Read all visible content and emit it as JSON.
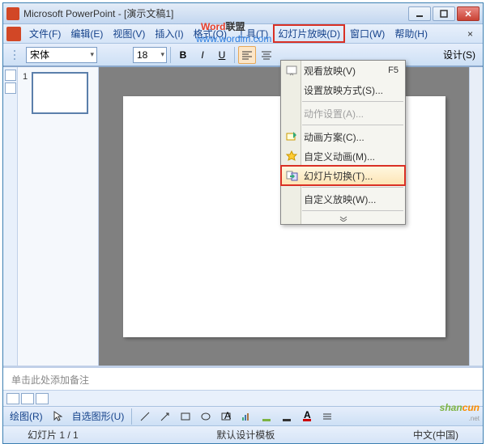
{
  "title": "Microsoft PowerPoint - [演示文稿1]",
  "menubar": {
    "file": "文件(F)",
    "edit": "编辑(E)",
    "view": "视图(V)",
    "insert": "插入(I)",
    "format": "格式(O)",
    "tools": "工具(T)",
    "slideshow": "幻灯片放映(D)",
    "window": "窗口(W)",
    "help": "帮助(H)"
  },
  "toolbar": {
    "font_name": "宋体",
    "font_size": "18",
    "design_btn": "设计(S)"
  },
  "dropdown": {
    "view_show": "观看放映(V)",
    "view_show_key": "F5",
    "setup_show": "设置放映方式(S)...",
    "action_settings": "动作设置(A)...",
    "animation_schemes": "动画方案(C)...",
    "custom_animation": "自定义动画(M)...",
    "slide_transition": "幻灯片切换(T)...",
    "custom_shows": "自定义放映(W)..."
  },
  "thumb": {
    "num": "1"
  },
  "notes": {
    "placeholder": "单击此处添加备注"
  },
  "drawbar": {
    "draw": "绘图(R)",
    "autoshapes": "自选图形(U)"
  },
  "status": {
    "slide": "幻灯片 1 / 1",
    "template": "默认设计模板",
    "lang": "中文(中国)"
  },
  "watermark": {
    "word": "Word",
    "union": "联盟",
    "url": "www.wordlm.com",
    "corner1": "shan",
    "corner2": "cun",
    "corner_sub": ".net"
  }
}
